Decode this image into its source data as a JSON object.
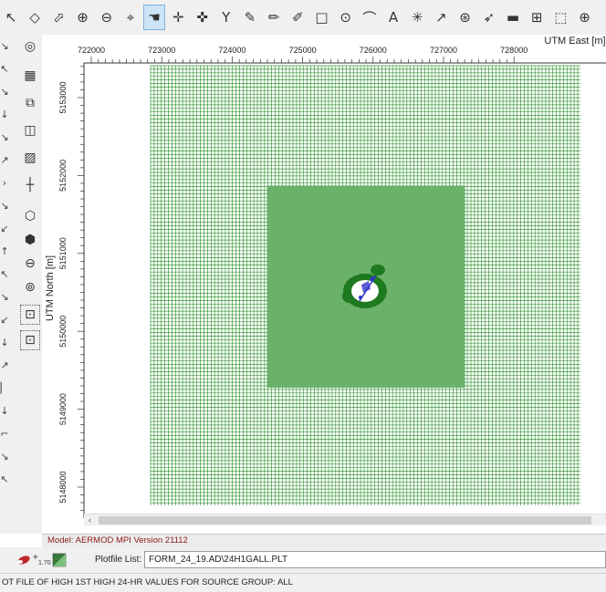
{
  "toolbar": {
    "tools": [
      {
        "name": "pointer-tool-icon",
        "glyph": "↖"
      },
      {
        "name": "select-tool-icon",
        "glyph": "◇"
      },
      {
        "name": "select-area-tool-icon",
        "glyph": "⬀"
      },
      {
        "name": "zoom-in-icon",
        "glyph": "⊕"
      },
      {
        "name": "zoom-out-icon",
        "glyph": "⊖"
      },
      {
        "name": "center-crosshair-icon",
        "glyph": "⌖"
      },
      {
        "name": "pan-hand-icon",
        "glyph": "☚"
      },
      {
        "name": "pan-cross-icon",
        "glyph": "✛"
      },
      {
        "name": "pan-cross-alt-icon",
        "glyph": "✜"
      },
      {
        "name": "funnel-icon",
        "glyph": "Y"
      },
      {
        "name": "pencil-icon",
        "glyph": "✎"
      },
      {
        "name": "pencil-edit-icon",
        "glyph": "✏"
      },
      {
        "name": "pencil-remove-icon",
        "glyph": "✐"
      },
      {
        "name": "rectangle-tool-icon",
        "glyph": "□"
      },
      {
        "name": "circle-tool-icon",
        "glyph": "⊙"
      },
      {
        "name": "polygon-tool-icon",
        "glyph": "⌒"
      },
      {
        "name": "text-tool-icon",
        "glyph": "A"
      },
      {
        "name": "asterisk-tool-icon",
        "glyph": "✳"
      },
      {
        "name": "arrow-tool-icon",
        "glyph": "↗"
      },
      {
        "name": "compass-tool-icon",
        "glyph": "⊛"
      },
      {
        "name": "north-arrow-icon",
        "glyph": "➶"
      },
      {
        "name": "scale-bar-icon",
        "glyph": "▬"
      },
      {
        "name": "building-tool-icon",
        "glyph": "⊞"
      },
      {
        "name": "frame-tool-icon",
        "glyph": "⬚"
      },
      {
        "name": "settings-wheel-icon",
        "glyph": "⊕"
      }
    ],
    "active_index": 6
  },
  "sidebar": {
    "buttons": [
      {
        "name": "target-icon",
        "glyph": "◎"
      },
      {
        "name": "grid-icon",
        "glyph": "▦"
      },
      {
        "name": "layers-icon",
        "glyph": "⧉"
      },
      {
        "name": "frame-select-icon",
        "glyph": "◫"
      },
      {
        "name": "hatch-area-icon",
        "glyph": "▨"
      },
      {
        "name": "axis-cross-icon",
        "glyph": "┼"
      },
      {
        "name": "source-point-icon",
        "glyph": "⬡"
      },
      {
        "name": "source-volume-icon",
        "glyph": "⬢"
      },
      {
        "name": "source-area-icon",
        "glyph": "⊖"
      },
      {
        "name": "source-stack-icon",
        "glyph": "⊚"
      },
      {
        "name": "receptor-grid-icon",
        "glyph": "⊡"
      },
      {
        "name": "receptor-discrete-icon",
        "glyph": "⊡"
      }
    ],
    "edge_glyphs": [
      "↘",
      "↖",
      "↘",
      "↓",
      "↘",
      "↗",
      "›",
      "↘",
      "↙",
      "↑",
      "↖",
      "↘",
      "↙",
      "↓",
      "↗",
      "▏",
      "↓",
      "⌐",
      "↘",
      "↖"
    ]
  },
  "plot": {
    "x_axis_title": "UTM East [m]",
    "y_axis_title": "UTM North [m]",
    "x_ticks": [
      "722000",
      "723000",
      "724000",
      "725000",
      "726000",
      "727000",
      "728000"
    ],
    "y_ticks": [
      "5153000",
      "5152000",
      "5151000",
      "5150000",
      "5149000",
      "5148000"
    ],
    "grid_color": "#1f8a1f",
    "source_color": "#3333cc"
  },
  "scrollbar": {
    "left_arrow": "‹"
  },
  "model_info": "Model: AERMOD MPI Version 21112",
  "plotfile": {
    "label": "Plotfile List:",
    "value": "FORM_24_19.AD\\24H1GALL.PLT"
  },
  "bottom_icons": {
    "contour_level": "1.70"
  },
  "status_text": "OT FILE OF HIGH 1ST HIGH 24-HR VALUES FOR SOURCE GROUP: ALL"
}
